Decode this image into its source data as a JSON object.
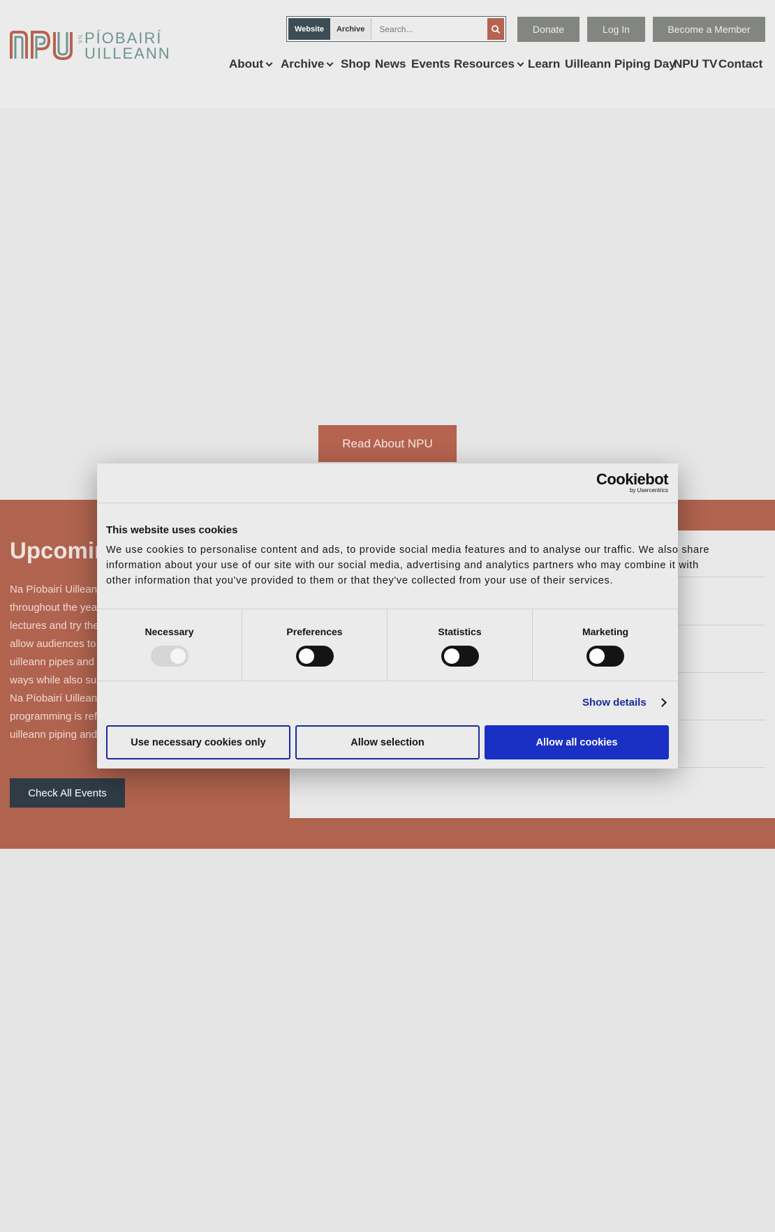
{
  "header": {
    "logo": {
      "abbr": "NPU",
      "na": "NA",
      "line1": "PÍOBAIRÍ",
      "line2": "UILLEANN"
    },
    "search": {
      "tab_website": "Website",
      "tab_archive": "Archive",
      "placeholder": "Search..."
    },
    "buttons": {
      "donate": "Donate",
      "login": "Log In",
      "member": "Become a Member"
    },
    "nav": [
      {
        "label": "About",
        "has_dropdown": true
      },
      {
        "label": "Archive",
        "has_dropdown": true
      },
      {
        "label": "Shop",
        "has_dropdown": false
      },
      {
        "label": "News",
        "has_dropdown": false
      },
      {
        "label": "Events",
        "has_dropdown": false
      },
      {
        "label": "Resources",
        "has_dropdown": true
      },
      {
        "label": "Learn",
        "has_dropdown": false
      },
      {
        "label": "Uilleann Piping Day",
        "has_dropdown": false
      },
      {
        "label": "NPU TV",
        "has_dropdown": false
      },
      {
        "label": "Contact",
        "has_dropdown": false
      }
    ]
  },
  "hero": {
    "read_button": "Read About NPU"
  },
  "events": {
    "title": "Upcoming",
    "description_lines": [
      "Na Píobairí Uilleann",
      "throughout the year",
      "lectures and try the",
      "allow audiences to",
      "uilleann pipes and t",
      "ways while also sup",
      "Na Píobairí Uilleann",
      "programming is ref",
      "uilleann piping and"
    ],
    "check_button": "Check All Events"
  },
  "cookie_dialog": {
    "brand": "Cookiebot",
    "brand_sub": "by Usercentrics",
    "title": "This website uses cookies",
    "body_lines": [
      "We use cookies to personalise content and ads, to provide social media features and to analyse our traffic. We also share",
      "information about your use of our site with our social media, advertising and analytics partners who may combine it with",
      "other information that you've provided to them or that they've collected from your use of their services."
    ],
    "categories": [
      {
        "label": "Necessary",
        "checked": true,
        "disabled": true
      },
      {
        "label": "Preferences",
        "checked": false,
        "disabled": false
      },
      {
        "label": "Statistics",
        "checked": false,
        "disabled": false
      },
      {
        "label": "Marketing",
        "checked": false,
        "disabled": false
      }
    ],
    "show_details": "Show details",
    "buttons": {
      "necessary_only": "Use necessary cookies only",
      "allow_selection": "Allow selection",
      "allow_all": "Allow all cookies"
    }
  },
  "colors": {
    "terracotta": "#b0634f",
    "slate": "#2f3c46",
    "cookiebot_blue": "#1a2fc4"
  }
}
